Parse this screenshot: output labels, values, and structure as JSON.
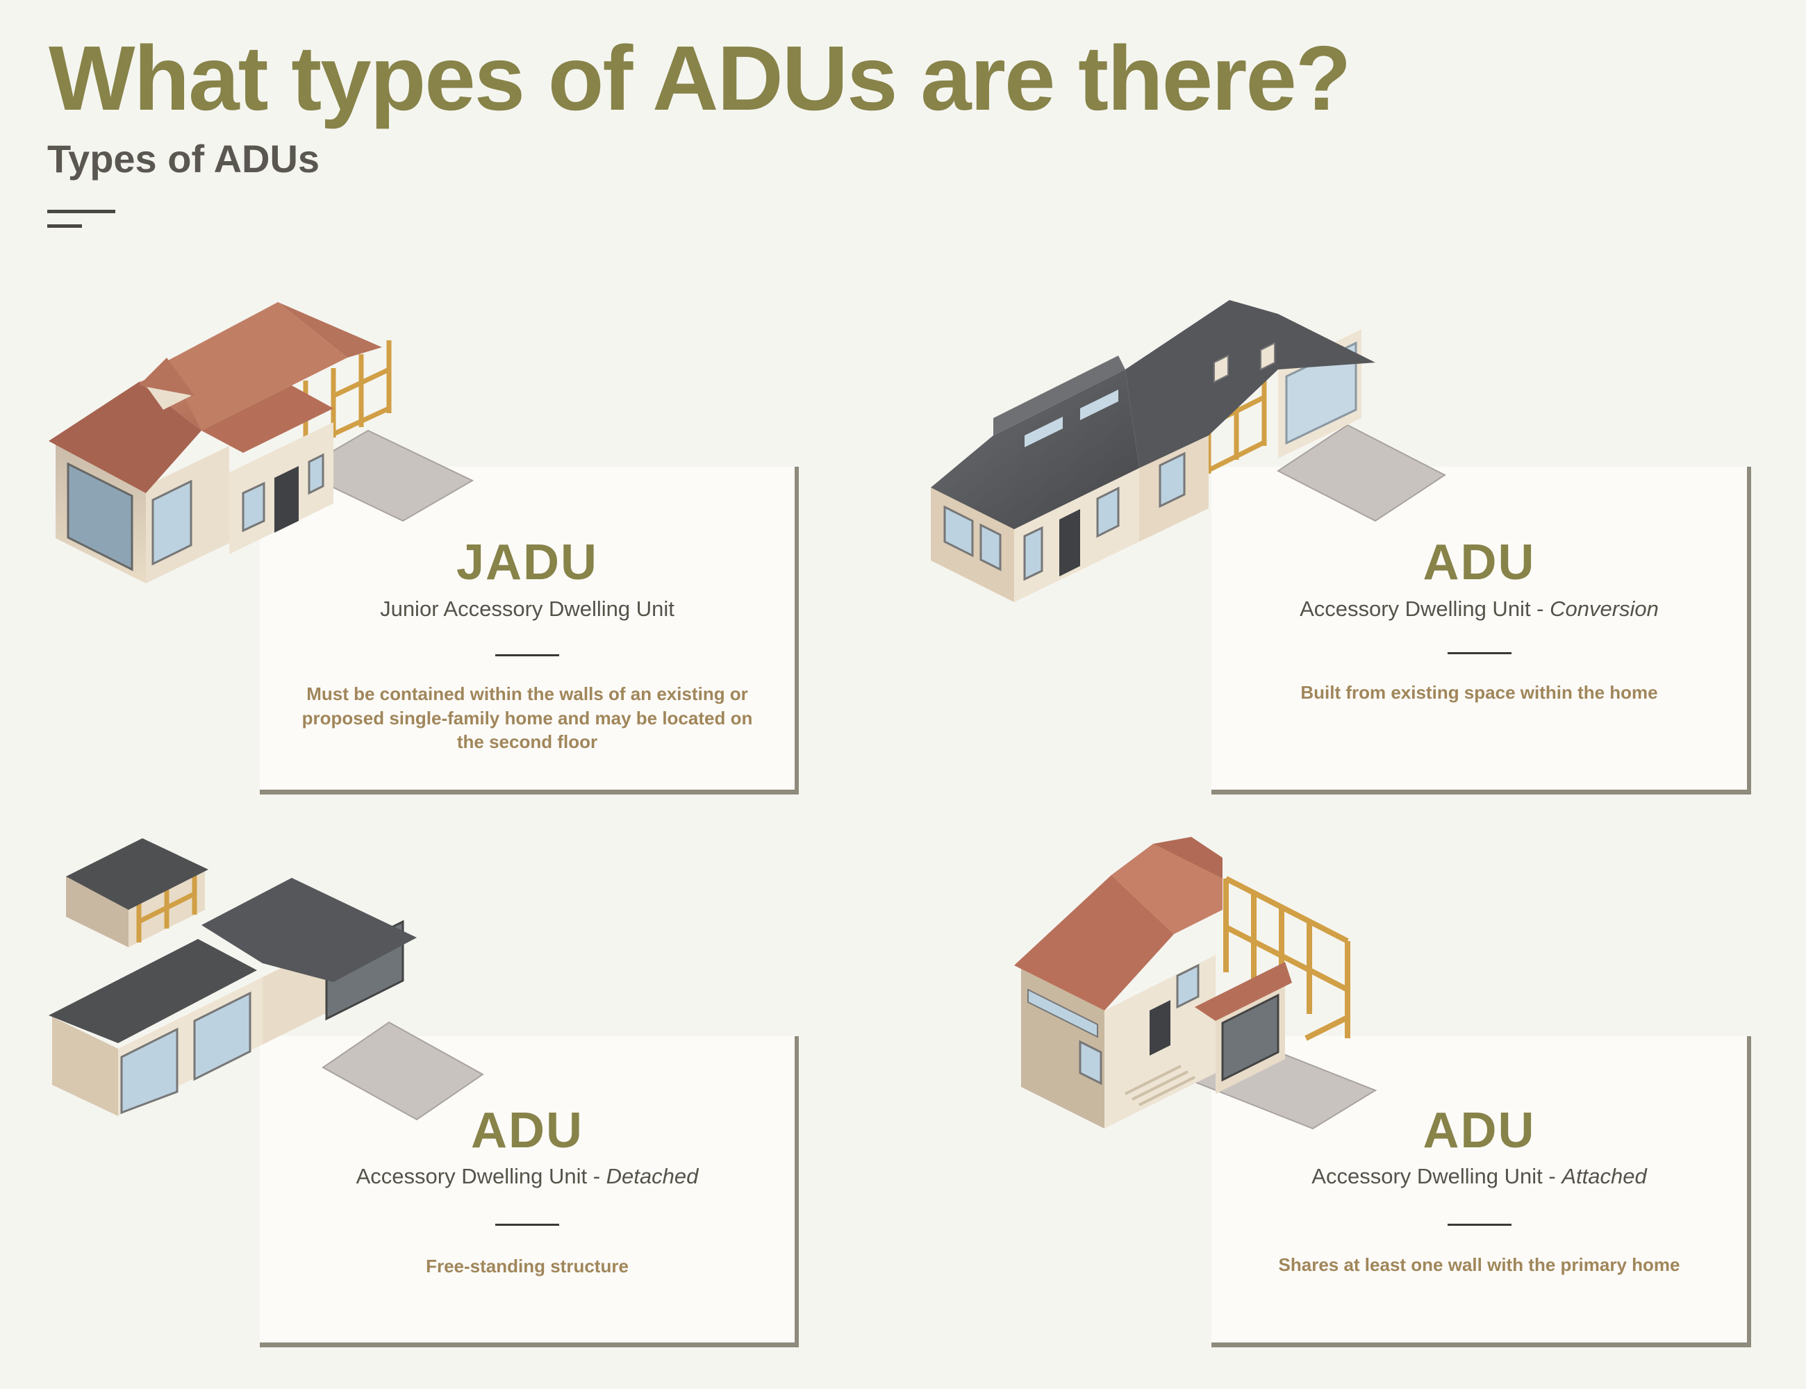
{
  "header": {
    "title": "What types of ADUs are there?",
    "subtitle": "Types of ADUs"
  },
  "cards": [
    {
      "title": "JADU",
      "subtitle": "Junior Accessory Dwelling Unit",
      "subtitle_emphasis": "",
      "description": "Must be contained within the walls of an existing or proposed single-family home and may be located on the second floor",
      "illustration": "single-story-house-with-hip-roof-and-framed-addition"
    },
    {
      "title": "ADU",
      "subtitle": "Accessory Dwelling Unit - ",
      "subtitle_emphasis": "Conversion",
      "description": "Built from existing space within the home",
      "illustration": "gray-roof-house-with-dormers-and-garage-conversion"
    },
    {
      "title": "ADU",
      "subtitle": "Accessory Dwelling Unit - ",
      "subtitle_emphasis": "Detached",
      "description": "Free-standing structure",
      "illustration": "flat-roof-house-with-separate-backyard-unit"
    },
    {
      "title": "ADU",
      "subtitle": "Accessory Dwelling Unit - ",
      "subtitle_emphasis": "Attached",
      "description": "Shares at least one wall with the primary home",
      "illustration": "two-story-house-with-attached-framed-addition"
    }
  ],
  "colors": {
    "background": "#f5f5f0",
    "title_olive": "#878349",
    "subtitle_gray": "#5a5750",
    "description_tan": "#a0865a",
    "card_shadow": "#8e8a7c",
    "roof_terracotta": "#b8705a",
    "roof_slate": "#4e5052",
    "wall_beige": "#e2d4be",
    "timber_frame": "#e0b35a",
    "driveway": "#c9c3c0"
  }
}
